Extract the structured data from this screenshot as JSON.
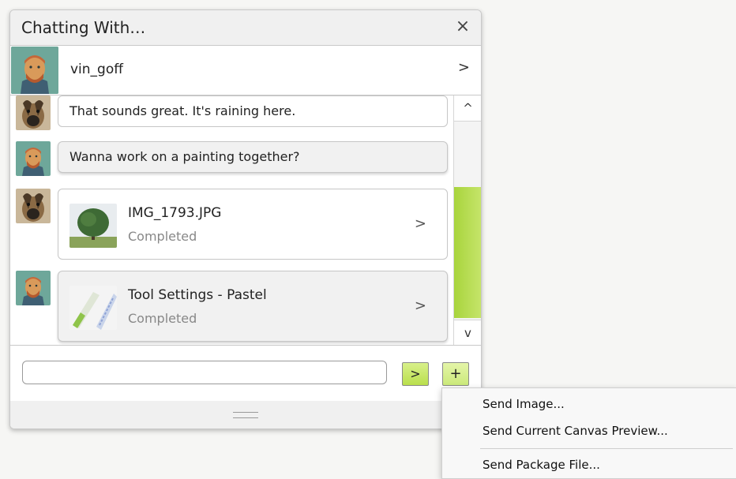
{
  "window": {
    "title": "Chatting With…",
    "close_glyph": "×",
    "close_icon": "close-icon"
  },
  "contact": {
    "name": "vin_goff",
    "chevron": ">"
  },
  "messages": [
    {
      "sender": "dog",
      "type": "text",
      "text": "That sounds great. It's raining here."
    },
    {
      "sender": "vin_goff",
      "type": "text",
      "text": "Wanna work on a painting together?"
    },
    {
      "sender": "dog",
      "type": "file",
      "filename": "IMG_1793.JPG",
      "status": "Completed",
      "chevron": ">"
    },
    {
      "sender": "vin_goff",
      "type": "file",
      "filename": "Tool Settings - Pastel",
      "status": "Completed",
      "chevron": ">"
    }
  ],
  "scrollbar": {
    "up_glyph": "^",
    "down_glyph": "v",
    "thumb_color": "#b8df4a"
  },
  "composer": {
    "input_value": "",
    "send_label": ">",
    "plus_label": "+"
  },
  "menu": {
    "items": [
      "Send Image...",
      "Send Current Canvas Preview...",
      "Send Package File..."
    ]
  },
  "colors": {
    "accent": "#b9df4c",
    "border": "#c9c9c9"
  }
}
